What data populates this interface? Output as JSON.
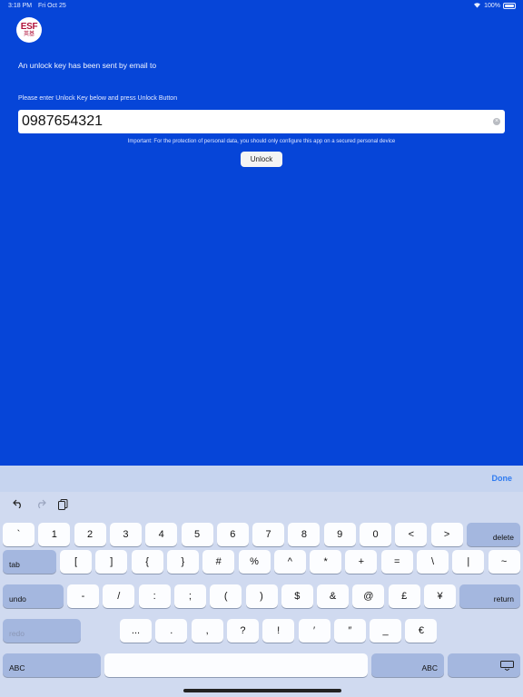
{
  "status": {
    "time": "3:18 PM",
    "date": "Fri Oct 25",
    "battery": "100%"
  },
  "logo": {
    "line1": "ESF",
    "line2": "英基"
  },
  "main": {
    "message": "An unlock key has been sent by email to",
    "prompt": "Please enter Unlock Key below and press Unlock Button",
    "key_value": "0987654321",
    "important": "Important: For the protection of personal data, you should only configure this app on a secured personal device",
    "unlock_label": "Unlock"
  },
  "keyboard": {
    "done_label": "Done",
    "row1": [
      "`",
      "1",
      "2",
      "3",
      "4",
      "5",
      "6",
      "7",
      "8",
      "9",
      "0",
      "<",
      ">"
    ],
    "delete_label": "delete",
    "tab_label": "tab",
    "row2": [
      "[",
      "]",
      "{",
      "}",
      "#",
      "%",
      "^",
      "*",
      "+",
      "=",
      "\\",
      "|",
      "~"
    ],
    "undo_label": "undo",
    "row3": [
      "-",
      "/",
      ":",
      ";",
      "(",
      ")",
      "$",
      "&",
      "@",
      "£",
      "¥"
    ],
    "return_label": "return",
    "redo_label": "redo",
    "row4": [
      "...",
      ".",
      ",",
      "?",
      "!",
      "′",
      "″",
      "_",
      "€"
    ],
    "abc_label": "ABC"
  }
}
